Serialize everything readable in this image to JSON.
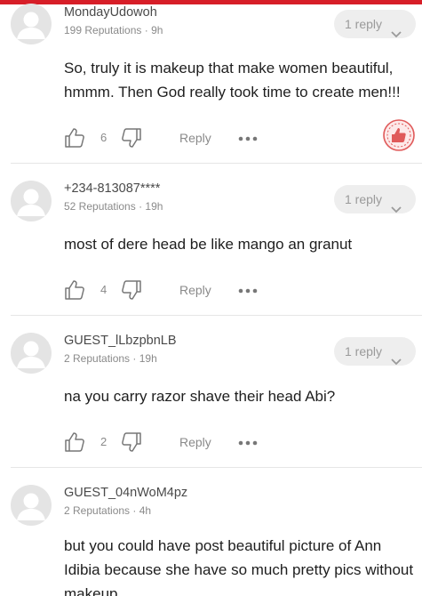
{
  "comments": [
    {
      "username": "MondayUdowoh",
      "reputation": "199 Reputations",
      "time": "9h",
      "reply_label": "1 reply",
      "text": "So, truly it is makeup that make women beautiful, hmmm. Then God really took time to create men!!!",
      "likes": "6",
      "reply_action": "Reply"
    },
    {
      "username": "+234-813087****",
      "reputation": "52 Reputations",
      "time": "19h",
      "reply_label": "1 reply",
      "text": "most of dere head be like mango an granut",
      "likes": "4",
      "reply_action": "Reply"
    },
    {
      "username": "GUEST_lLbzpbnLB",
      "reputation": "2 Reputations",
      "time": "19h",
      "reply_label": "1 reply",
      "text": "na you carry razor shave their head Abi?",
      "likes": "2",
      "reply_action": "Reply"
    },
    {
      "username": "GUEST_04nWoM4pz",
      "reputation": "2 Reputations",
      "time": "4h",
      "text": "but you could have post beautiful picture of Ann Idibia because she have so much pretty pics without makeup"
    }
  ],
  "meta_separator": " · ",
  "colors": {
    "accent": "#d71e28",
    "pill_bg": "#eeeeee",
    "muted": "#8a8a8a",
    "divider": "#e6e6e6"
  },
  "icons": [
    "avatar-placeholder-icon",
    "chevron-down-icon",
    "thumb-up-icon",
    "thumb-down-icon",
    "more-dots-icon",
    "thumb-up-badge-icon"
  ]
}
